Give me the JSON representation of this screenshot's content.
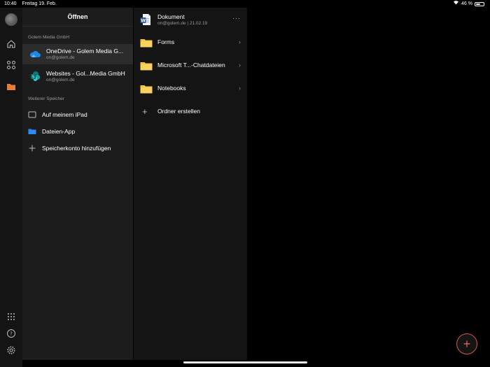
{
  "status": {
    "time": "10:40",
    "date": "Freitag 19. Feb.",
    "battery": "46 %",
    "battery_level": 0.46
  },
  "rail": {
    "icons": [
      "avatar",
      "home-icon",
      "grid-icon",
      "folder-icon",
      "apps-icon",
      "help-icon",
      "gear-icon"
    ]
  },
  "nav": {
    "title": "Öffnen",
    "section_org": "Golem Media GmbH",
    "accounts": [
      {
        "title": "OneDrive - Golem Media G...",
        "subtitle": "on@golem.de"
      },
      {
        "title": "Websites - Gol...Media GmbH",
        "subtitle": "on@golem.de"
      }
    ],
    "section_other": "Weiterer Speicher",
    "items": [
      {
        "label": "Auf meinem iPad"
      },
      {
        "label": "Dateien-App"
      },
      {
        "label": "Speicherkonto hinzufügen"
      }
    ]
  },
  "content": {
    "document": {
      "title": "Dokument",
      "subtitle": "on@golem.de | 21.02.19",
      "more": "···"
    },
    "folders": [
      {
        "label": "Forms"
      },
      {
        "label": "Microsoft T...-Chatdateien"
      },
      {
        "label": "Notebooks"
      }
    ],
    "add_folder": "Ordner erstellen"
  },
  "fab": {
    "label": "+"
  },
  "colors": {
    "accent": "#d9534f",
    "folder": "#f5c542",
    "word": "#2b5797",
    "onedrive": "#1e88e5"
  }
}
